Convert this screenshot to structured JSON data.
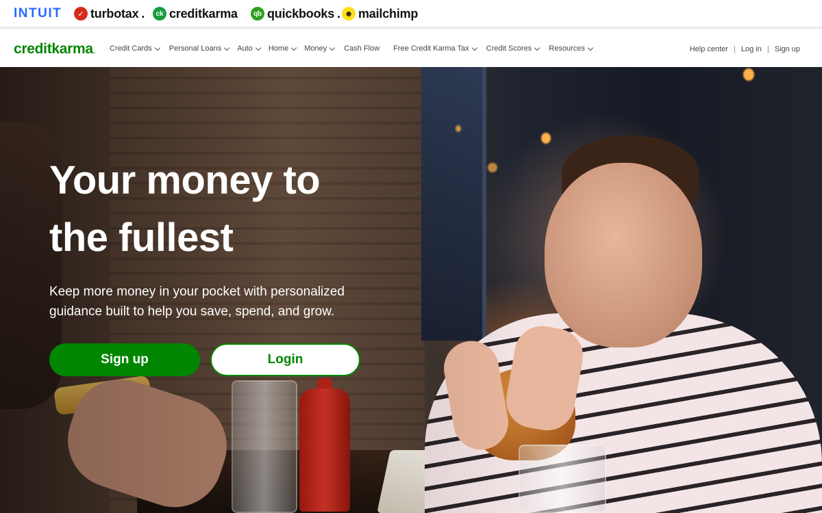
{
  "brand_bar": {
    "intuit": "INTUIT",
    "turbotax": "turbotax",
    "turbotax_mark": "✓",
    "creditkarma": "creditkarma",
    "creditkarma_mark": "ck",
    "quickbooks": "quickbooks",
    "quickbooks_mark": "qb",
    "mailchimp": "mailchimp",
    "mailchimp_mark": "☻",
    "colors": {
      "intuit": "#236cff",
      "turbotax": "#d52b1e",
      "creditkarma": "#1a9c3e",
      "quickbooks": "#2ca01c",
      "mailchimp": "#ffe01b"
    }
  },
  "nav": {
    "logo": "creditkarma",
    "logo_tm": ".",
    "links": [
      {
        "label": "Credit Cards",
        "dropdown": true
      },
      {
        "label": "Personal Loans",
        "dropdown": true
      },
      {
        "label": "Auto",
        "dropdown": true
      },
      {
        "label": "Home",
        "dropdown": true
      },
      {
        "label": "Money",
        "dropdown": true
      },
      {
        "label": "Cash Flow",
        "dropdown": false
      },
      {
        "label": "Free Credit Karma Tax",
        "dropdown": true
      },
      {
        "label": "Credit Scores",
        "dropdown": true
      },
      {
        "label": "Resources",
        "dropdown": true
      }
    ],
    "help": "Help center",
    "separator": "|",
    "login": "Log in",
    "signup": "Sign up"
  },
  "hero": {
    "headline_line1": "Your money to",
    "headline_line2": "the fullest",
    "subtext_line1": "Keep more money in your pocket with personalized",
    "subtext_line2": "guidance built to help you save, spend, and grow.",
    "signup_button": "Sign up",
    "login_button": "Login",
    "accent_color": "#008600"
  }
}
